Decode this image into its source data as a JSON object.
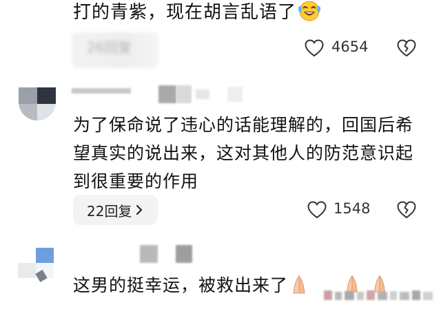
{
  "comment1": {
    "text": "打的青紫，现在胡言乱语了",
    "emoji": "laughing-crying-emoji",
    "reply_label_obscured": "26回复",
    "likes": "4654"
  },
  "comment2": {
    "text": "为了保命说了违心的话能理解的，回国后希望真实的说出来，这对其他人的防范意识起到很重要的作用",
    "reply_label": "22回复",
    "likes": "1548"
  },
  "comment3": {
    "text": "这男的挺幸运，被救出来了",
    "emoji": "praying-hands-emoji"
  },
  "icons": {
    "like": "heart-outline-icon",
    "dislike": "broken-heart-icon",
    "reply_chevron": "chevron-right-icon"
  },
  "colors": {
    "text": "#111111",
    "muted": "#333333",
    "chip": "#f2f3f5",
    "icon": "#333333"
  }
}
